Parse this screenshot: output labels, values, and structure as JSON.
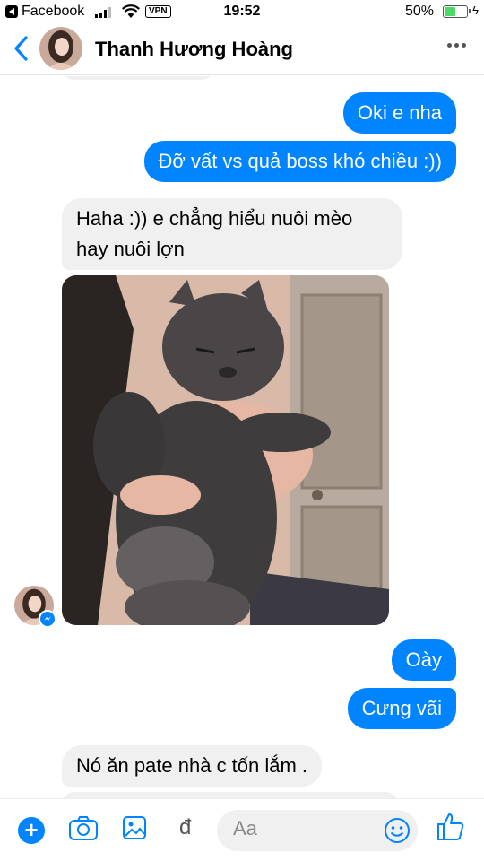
{
  "status_bar": {
    "back_app": "Facebook",
    "vpn": "VPN",
    "time": "19:52",
    "battery_text": "50%",
    "battery_level": 0.5
  },
  "header": {
    "contact_name": "Thanh Hương Hoàng"
  },
  "messages": {
    "out_1": "Oki e nha",
    "out_2": "Đỡ vất vs quả boss khó chiều :))",
    "in_1_line1": "Haha :)) e chẳng hiểu nuôi mèo",
    "in_1_line2": "hay nuôi lợn",
    "out_3": "Oày",
    "out_4": "Cưng vãi",
    "in_2": "Nó ăn pate nhà c tốn lắm ."
  },
  "composer": {
    "placeholder": "Aa",
    "currency_glyph": "đ"
  },
  "colors": {
    "accent": "#0084ff",
    "incoming_bubble": "#f1f0f0"
  }
}
